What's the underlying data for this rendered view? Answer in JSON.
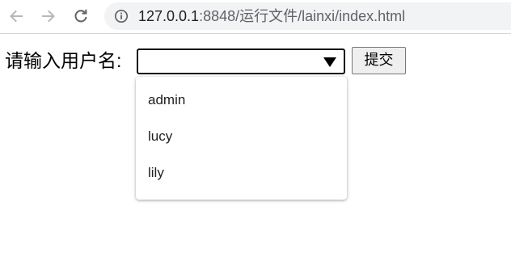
{
  "browser": {
    "url_host": "127.0.0.1",
    "url_rest": ":8848/运行文件/lainxi/index.html"
  },
  "form": {
    "label": "请输入用户名:",
    "select_value": "",
    "options": [
      {
        "label": "admin"
      },
      {
        "label": "lucy"
      },
      {
        "label": "lily"
      }
    ],
    "submit_label": "提交"
  },
  "icons": {
    "back": "arrow-left-icon",
    "forward": "arrow-right-icon",
    "reload": "reload-icon",
    "info": "info-icon",
    "dropdown": "triangle-down-icon"
  },
  "colors": {
    "nav_icon": "#5f6368",
    "omnibox_bg": "#f1f3f4",
    "select_border": "#101010",
    "button_bg": "#efefef"
  }
}
